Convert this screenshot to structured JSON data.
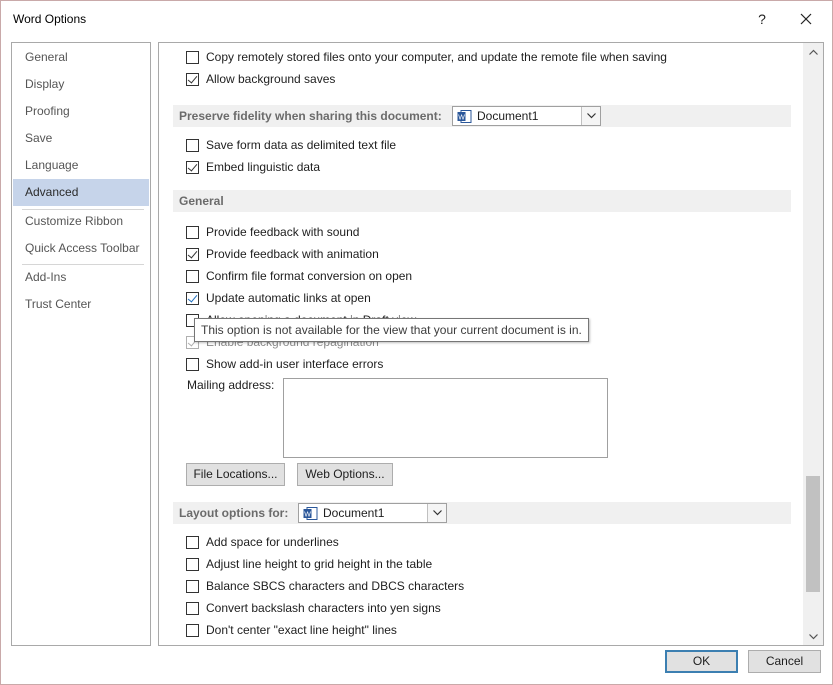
{
  "window": {
    "title": "Word Options",
    "help_label": "?",
    "close_icon": "close-icon"
  },
  "sidebar": {
    "items": [
      {
        "label": "General"
      },
      {
        "label": "Display"
      },
      {
        "label": "Proofing"
      },
      {
        "label": "Save"
      },
      {
        "label": "Language"
      },
      {
        "label": "Advanced",
        "selected": true
      },
      {
        "label": "Customize Ribbon"
      },
      {
        "label": "Quick Access Toolbar"
      },
      {
        "label": "Add-Ins"
      },
      {
        "label": "Trust Center"
      }
    ]
  },
  "content": {
    "top_options": [
      {
        "label": "Copy remotely stored files onto your computer, and update the remote file when saving",
        "checked": false
      },
      {
        "label": "Allow background saves",
        "checked": true
      }
    ],
    "fidelity_section": {
      "label": "Preserve fidelity when sharing this document:",
      "document": "Document1",
      "options": [
        {
          "label": "Save form data as delimited text file",
          "checked": false
        },
        {
          "label": "Embed linguistic data",
          "checked": true
        }
      ]
    },
    "general_section": {
      "label": "General",
      "options": [
        {
          "label": "Provide feedback with sound",
          "checked": false
        },
        {
          "label": "Provide feedback with animation",
          "checked": true
        },
        {
          "label": "Confirm file format conversion on open",
          "checked": false
        },
        {
          "label": "Update automatic links at open",
          "checked": true
        },
        {
          "label": "Allow opening a document in Draft view",
          "checked": false
        },
        {
          "label": "Enable background repagination",
          "checked": true,
          "disabled": true
        },
        {
          "label": "Show add-in user interface errors",
          "checked": false
        }
      ],
      "tooltip": "This option is not available for the view that your current document is in.",
      "mailing_address_label": "Mailing address:",
      "mailing_address_value": "",
      "file_locations_button": "File Locations...",
      "web_options_button": "Web Options..."
    },
    "layout_section": {
      "label": "Layout options for:",
      "document": "Document1",
      "options": [
        {
          "label": "Add space for underlines",
          "checked": false
        },
        {
          "label": "Adjust line height to grid height in the table",
          "checked": false
        },
        {
          "label": "Balance SBCS characters and DBCS characters",
          "checked": false
        },
        {
          "label": "Convert backslash characters into yen signs",
          "checked": false
        },
        {
          "label": "Don't center \"exact line height\" lines",
          "checked": false
        }
      ]
    }
  },
  "footer": {
    "ok_label": "OK",
    "cancel_label": "Cancel"
  }
}
